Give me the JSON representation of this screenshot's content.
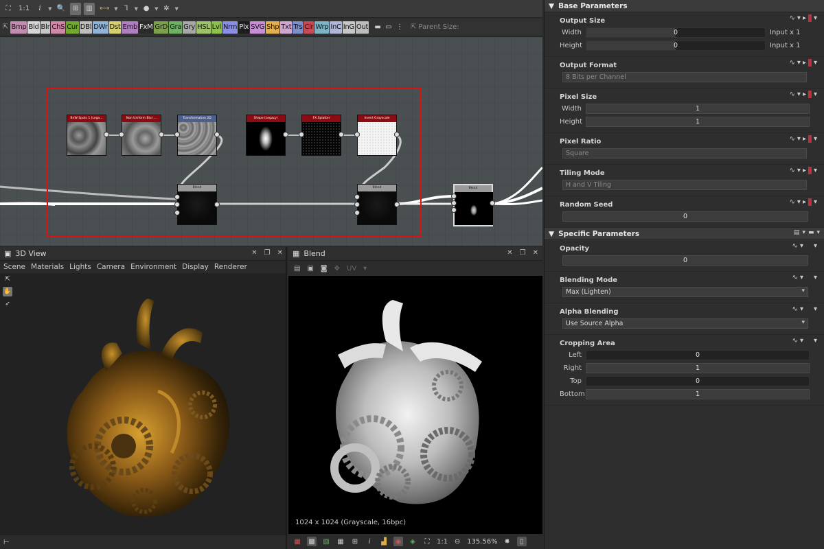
{
  "toolbar": {
    "zoom_label": "1:1",
    "info_label": "i"
  },
  "node_chips": [
    {
      "label": "Bmp",
      "color": "#c28db0"
    },
    {
      "label": "Bld",
      "color": "#d6d6d6"
    },
    {
      "label": "Blr",
      "color": "#c7c7c7"
    },
    {
      "label": "ChS",
      "color": "#d088a8"
    },
    {
      "label": "Cur",
      "color": "#72a832"
    },
    {
      "label": "DBl",
      "color": "#bdbdbd"
    },
    {
      "label": "DWr",
      "color": "#8fb4d8"
    },
    {
      "label": "Dst",
      "color": "#d6cf72"
    },
    {
      "label": "Emb",
      "color": "#b07fc0"
    },
    {
      "label": "FxM",
      "color": "#2a2a2a"
    },
    {
      "label": "GrD",
      "color": "#7da04e"
    },
    {
      "label": "Gra",
      "color": "#6fb067"
    },
    {
      "label": "Gry",
      "color": "#a8a8a8"
    },
    {
      "label": "HSL",
      "color": "#9fc36c"
    },
    {
      "label": "Lvl",
      "color": "#8dc04d"
    },
    {
      "label": "Nrm",
      "color": "#8b8fe6"
    },
    {
      "label": "Plx",
      "color": "#1d1d1d"
    },
    {
      "label": "SVG",
      "color": "#c78fd4"
    },
    {
      "label": "Shp",
      "color": "#e0b052"
    },
    {
      "label": "Txt",
      "color": "#cfa6cf"
    },
    {
      "label": "Trs",
      "color": "#7b8fc9"
    },
    {
      "label": "Clr",
      "color": "#c64b55"
    },
    {
      "label": "Wrp",
      "color": "#7fb4c4"
    },
    {
      "label": "InC",
      "color": "#b0b6d8"
    },
    {
      "label": "InG",
      "color": "#c7c7c7"
    },
    {
      "label": "Out",
      "color": "#bdbdbd"
    }
  ],
  "parent_size_label": "Parent Size:",
  "graph_nodes": [
    {
      "title": "BnW Spots 1 (Lega...",
      "color": "#8a0c12"
    },
    {
      "title": "Non Uniform Blur ...",
      "color": "#8a0c12"
    },
    {
      "title": "Transformation 2D",
      "color": "#4d5f8a"
    },
    {
      "title": "Shape (Legacy)",
      "color": "#8a0c12"
    },
    {
      "title": "FX Splatter",
      "color": "#8a0c12"
    },
    {
      "title": "Invert Grayscale",
      "color": "#8a0c12"
    },
    {
      "title": "Blend",
      "color": "#9a9a9a"
    },
    {
      "title": "Blend",
      "color": "#9a9a9a"
    },
    {
      "title": "Blend",
      "color": "#9a9a9a"
    }
  ],
  "view3d": {
    "title": "3D View",
    "menu": [
      "Scene",
      "Materials",
      "Lights",
      "Camera",
      "Environment",
      "Display",
      "Renderer"
    ]
  },
  "view2d": {
    "title": "Blend",
    "uv_label": "UV",
    "info": "1024 x 1024 (Grayscale, 16bpc)",
    "ratio": "1:1",
    "zoom": "135.56%"
  },
  "base_params": {
    "title": "Base Parameters",
    "output_size": {
      "title": "Output Size",
      "width_label": "Width",
      "width_value": "0",
      "width_suffix": "Input x 1",
      "height_label": "Height",
      "height_value": "0",
      "height_suffix": "Input x 1"
    },
    "output_format": {
      "title": "Output Format",
      "value": "8 Bits per Channel"
    },
    "pixel_size": {
      "title": "Pixel Size",
      "width_label": "Width",
      "width_value": "1",
      "height_label": "Height",
      "height_value": "1"
    },
    "pixel_ratio": {
      "title": "Pixel Ratio",
      "value": "Square"
    },
    "tiling_mode": {
      "title": "Tiling Mode",
      "value": "H and V Tiling"
    },
    "random_seed": {
      "title": "Random Seed",
      "value": "0"
    }
  },
  "specific_params": {
    "title": "Specific Parameters",
    "opacity": {
      "title": "Opacity",
      "value": "0"
    },
    "blending_mode": {
      "title": "Blending Mode",
      "value": "Max (Lighten)"
    },
    "alpha_blending": {
      "title": "Alpha Blending",
      "value": "Use Source Alpha"
    },
    "cropping_area": {
      "title": "Cropping Area",
      "left_label": "Left",
      "left_value": "0",
      "right_label": "Right",
      "right_value": "1",
      "top_label": "Top",
      "top_value": "0",
      "bottom_label": "Bottom",
      "bottom_value": "1"
    }
  },
  "colors": {
    "graph_bg": "#4a4f51",
    "selection": "#e01010",
    "param_accent": "#c0303a"
  }
}
